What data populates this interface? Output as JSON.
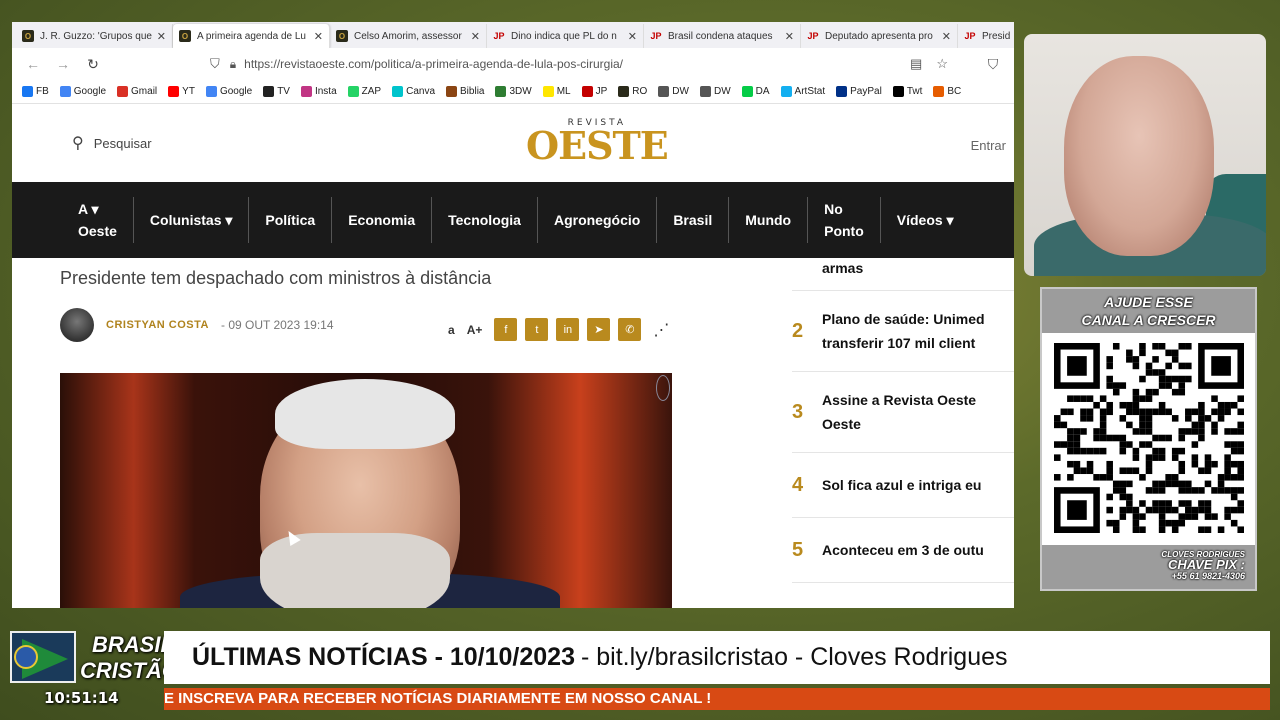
{
  "browser": {
    "tabs": [
      {
        "title": "J. R. Guzzo: 'Grupos que",
        "fav": "O",
        "type": "o"
      },
      {
        "title": "A primeira agenda de Lu",
        "fav": "O",
        "type": "o",
        "active": true
      },
      {
        "title": "Celso Amorim, assessor",
        "fav": "O",
        "type": "o"
      },
      {
        "title": "Dino indica que PL do n",
        "fav": "JP",
        "type": "jp"
      },
      {
        "title": "Brasil condena ataques",
        "fav": "JP",
        "type": "jp"
      },
      {
        "title": "Deputado apresenta pro",
        "fav": "JP",
        "type": "jp"
      },
      {
        "title": "Presid",
        "fav": "JP",
        "type": "jp"
      }
    ],
    "url": "https://revistaoeste.com/politica/a-primeira-agenda-de-lula-pos-cirurgia/",
    "bookmarks": [
      {
        "label": "FB",
        "color": "#1877f2"
      },
      {
        "label": "Google",
        "color": "#4285f4"
      },
      {
        "label": "Gmail",
        "color": "#d93025"
      },
      {
        "label": "YT",
        "color": "#ff0000"
      },
      {
        "label": "Google",
        "color": "#4285f4"
      },
      {
        "label": "TV",
        "color": "#222222"
      },
      {
        "label": "Insta",
        "color": "#c13584"
      },
      {
        "label": "ZAP",
        "color": "#25d366"
      },
      {
        "label": "Canva",
        "color": "#00c4cc"
      },
      {
        "label": "Biblia",
        "color": "#8b4513"
      },
      {
        "label": "3DW",
        "color": "#2e7d32"
      },
      {
        "label": "ML",
        "color": "#ffe600"
      },
      {
        "label": "JP",
        "color": "#c40000"
      },
      {
        "label": "RO",
        "color": "#2a2a1a"
      },
      {
        "label": "DW",
        "color": "#555555"
      },
      {
        "label": "DW",
        "color": "#555555"
      },
      {
        "label": "DA",
        "color": "#05cc47"
      },
      {
        "label": "ArtStat",
        "color": "#13aff0"
      },
      {
        "label": "PayPal",
        "color": "#003087"
      },
      {
        "label": "Twt",
        "color": "#000000"
      },
      {
        "label": "BC",
        "color": "#e65c00"
      }
    ]
  },
  "site": {
    "search_label": "Pesquisar",
    "logo_small": "REVISTA",
    "logo_big": "OESTE",
    "login": "Entrar",
    "menu": [
      {
        "label": "A ▾\nOeste"
      },
      {
        "label": "Colunistas ▾"
      },
      {
        "label": "Política"
      },
      {
        "label": "Economia"
      },
      {
        "label": "Tecnologia"
      },
      {
        "label": "Agronegócio"
      },
      {
        "label": "Brasil"
      },
      {
        "label": "Mundo"
      },
      {
        "label": "No\nPonto"
      },
      {
        "label": "Vídeos ▾"
      }
    ]
  },
  "article": {
    "subtitle": "Presidente tem despachado com ministros à distância",
    "author": "CRISTYAN COSTA",
    "date": "09 OUT 2023 19:14",
    "text_small": "a",
    "text_large": "A+",
    "share_icons": [
      "f",
      "t",
      "in",
      "➤",
      "✆"
    ]
  },
  "sidebar": {
    "top_text": "armas",
    "items": [
      {
        "num": "2",
        "text": "Plano de saúde: Unimed\ntransferir 107 mil client"
      },
      {
        "num": "3",
        "text": "Assine a Revista Oeste\nOeste"
      },
      {
        "num": "4",
        "text": "Sol fica azul e intriga eu"
      },
      {
        "num": "5",
        "text": "Aconteceu em 3 de outu"
      }
    ]
  },
  "donate": {
    "header_line1": "AJUDE ESSE",
    "header_line2": "CANAL A CRESCER",
    "footer_name": "CLOVES RODRIGUES",
    "footer_pix": "CHAVE PIX :",
    "footer_phone": "+55 61 9821-4306"
  },
  "overlay": {
    "logo_line1": "BRASIL",
    "logo_line2": "CRISTÃO",
    "clock": "10:51:14",
    "headline_bold": "ÚLTIMAS NOTÍCIAS - 10/10/2023",
    "headline_rest": "- bit.ly/brasilcristao - Cloves Rodrigues",
    "ticker": "E INSCREVA PARA RECEBER NOTÍCIAS DIARIAMENTE EM NOSSO CANAL !"
  }
}
